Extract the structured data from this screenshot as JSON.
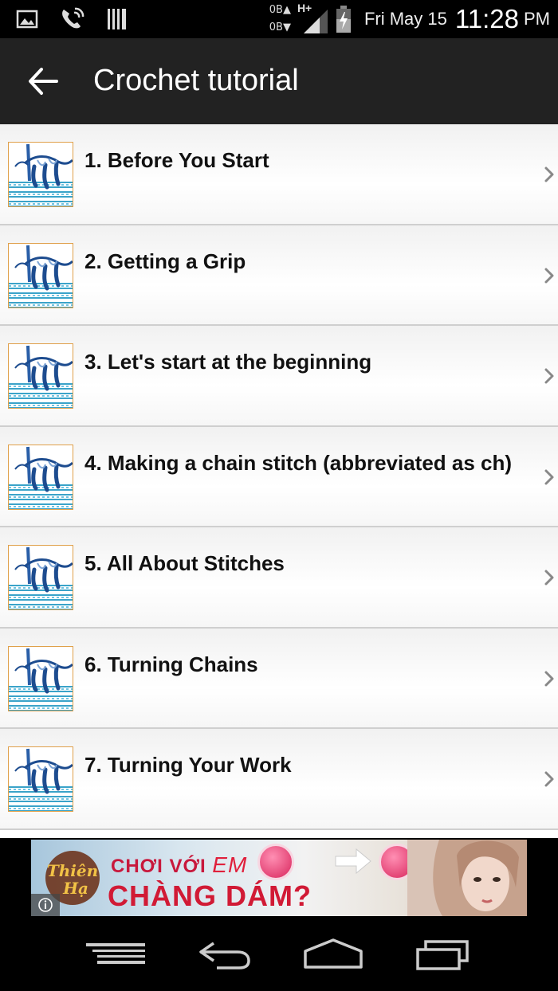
{
  "status_bar": {
    "data_up": "0B",
    "data_down": "0B",
    "network_type": "H+",
    "date": "Fri May 15",
    "time": "11:28",
    "ampm": "PM"
  },
  "app_bar": {
    "title": "Crochet tutorial",
    "back_icon": "arrow-left-icon"
  },
  "items": [
    {
      "label": "1. Before You Start"
    },
    {
      "label": "2. Getting a Grip"
    },
    {
      "label": "3. Let's start at the beginning"
    },
    {
      "label": "4. Making a chain stitch (abbreviated as ch)"
    },
    {
      "label": "5. All About Stitches"
    },
    {
      "label": "6. Turning Chains"
    },
    {
      "label": "7. Turning Your Work"
    }
  ],
  "ad": {
    "line1_prefix": "CHƠI VỚI",
    "line1_em": "EM",
    "line2": "CHÀNG DÁM?",
    "logo_text": "Thiên Hạ"
  },
  "colors": {
    "app_bar": "#222222",
    "accent_red": "#d11a35",
    "thumb_border": "#e0a04a"
  }
}
